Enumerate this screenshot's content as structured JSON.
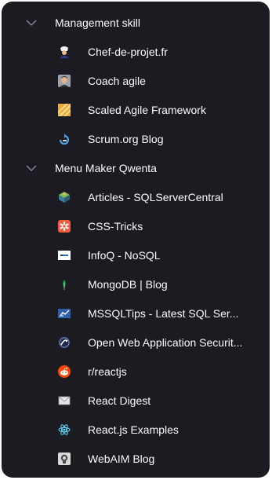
{
  "folders": [
    {
      "label": "Management skill",
      "expanded": true,
      "items": [
        {
          "label": "Chef-de-projet.fr",
          "icon": "chef-de-projet-favicon-icon"
        },
        {
          "label": "Coach agile",
          "icon": "coach-agile-favicon-icon"
        },
        {
          "label": "Scaled Agile Framework",
          "icon": "scaled-agile-favicon-icon"
        },
        {
          "label": "Scrum.org Blog",
          "icon": "scrum-org-favicon-icon"
        }
      ]
    },
    {
      "label": "Menu Maker Qwenta",
      "expanded": true,
      "items": [
        {
          "label": "Articles - SQLServerCentral",
          "icon": "sqlservercentral-favicon-icon"
        },
        {
          "label": "CSS-Tricks",
          "icon": "css-tricks-favicon-icon"
        },
        {
          "label": "InfoQ - NoSQL",
          "icon": "infoq-favicon-icon"
        },
        {
          "label": "MongoDB | Blog",
          "icon": "mongodb-leaf-icon"
        },
        {
          "label": "MSSQLTips - Latest SQL Ser...",
          "icon": "mssqltips-favicon-icon"
        },
        {
          "label": "Open Web Application Securit...",
          "icon": "owasp-favicon-icon"
        },
        {
          "label": "r/reactjs",
          "icon": "reddit-favicon-icon"
        },
        {
          "label": "React Digest",
          "icon": "react-digest-envelope-icon"
        },
        {
          "label": "React.js Examples",
          "icon": "react-atom-icon"
        },
        {
          "label": "WebAIM Blog",
          "icon": "webaim-favicon-icon"
        }
      ]
    }
  ],
  "colors": {
    "panel_background": "#1c1b22",
    "text": "#fbfbfe",
    "chevron": "#8f8f9d"
  }
}
